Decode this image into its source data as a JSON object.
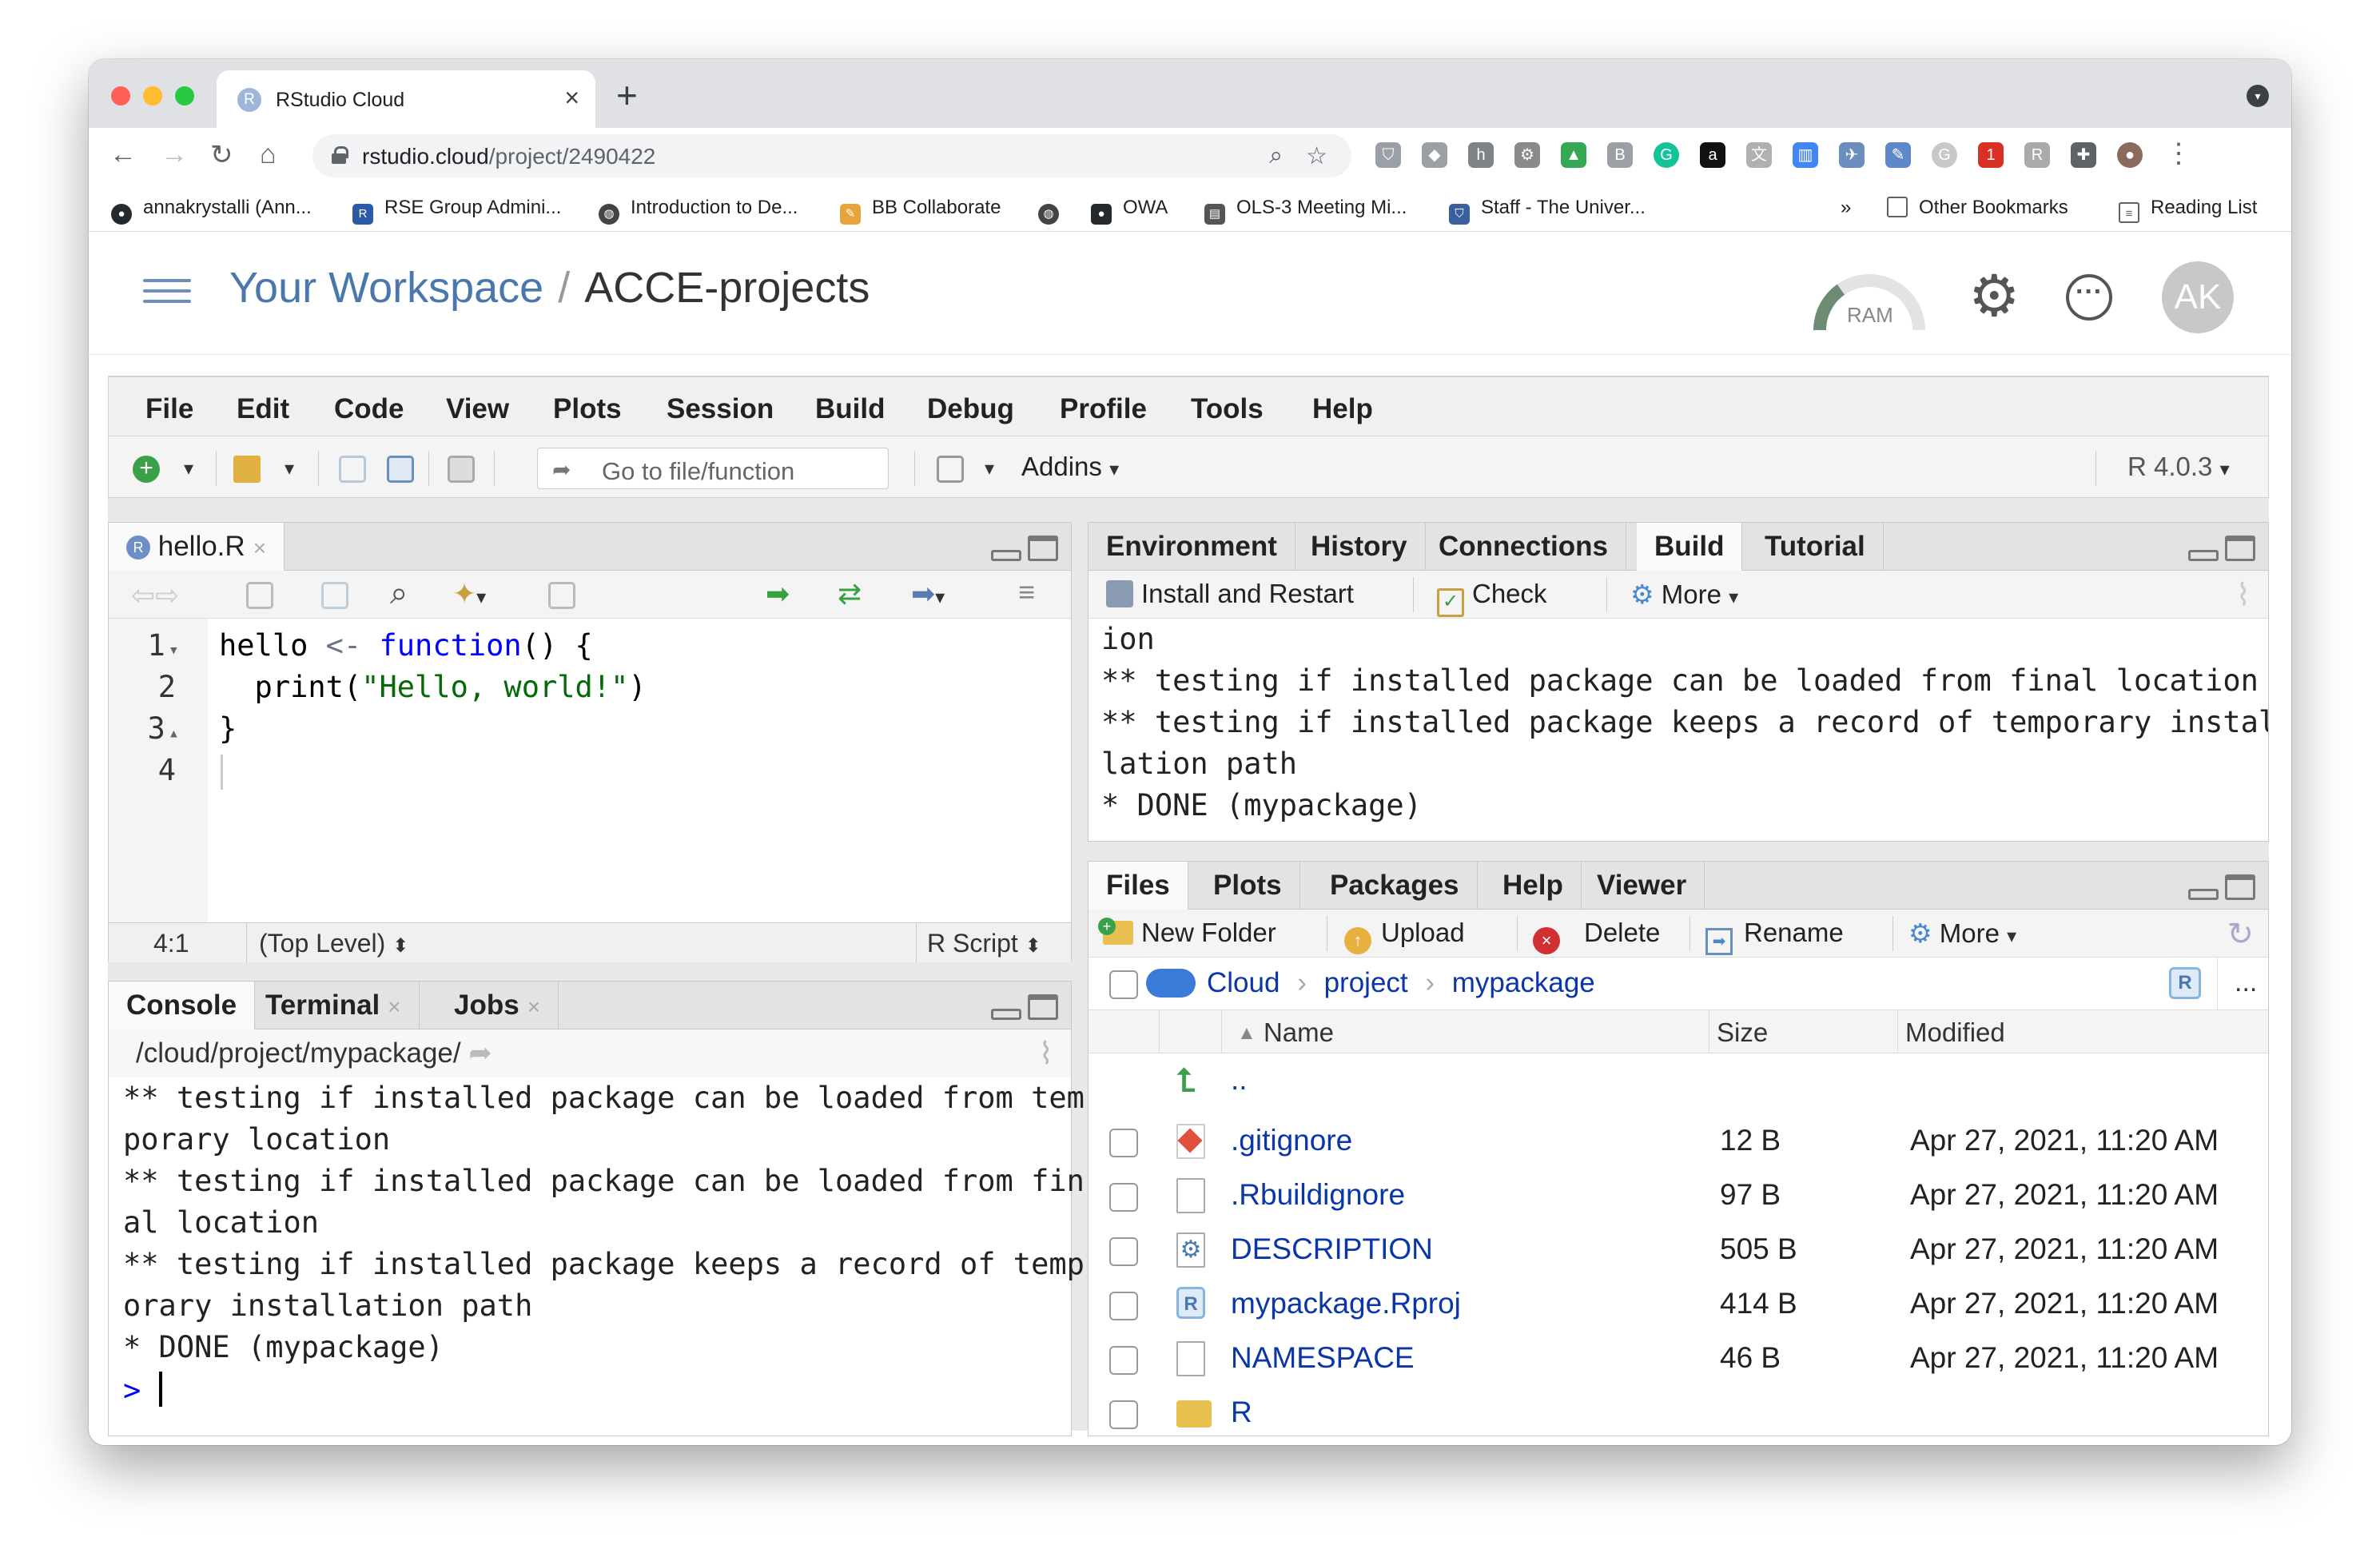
{
  "browser": {
    "tab_title": "RStudio Cloud",
    "tab_favicon": "R",
    "url_host": "rstudio.cloud",
    "url_path": "/project/2490422",
    "bookmarks": [
      {
        "label": "annakrystalli (Ann...",
        "icon": "github-icon",
        "color": "#24292e"
      },
      {
        "label": "RSE Group Admini...",
        "icon": "rse-icon",
        "color": "#2a5aa8"
      },
      {
        "label": "Introduction to De...",
        "icon": "globe-icon",
        "color": "#444"
      },
      {
        "label": "BB Collaborate",
        "icon": "pencil-icon",
        "color": "#e8a33b"
      },
      {
        "label": "",
        "icon": "globe-icon",
        "color": "#444"
      },
      {
        "label": "OWA",
        "icon": "github-icon",
        "color": "#24292e"
      },
      {
        "label": "OLS-3 Meeting Mi...",
        "icon": "document-icon",
        "color": "#555"
      },
      {
        "label": "Staff - The Univer...",
        "icon": "shield-icon",
        "color": "#3a5fa0"
      }
    ],
    "more_bookmarks": "»",
    "other_bookmarks": "Other Bookmarks",
    "reading_list": "Reading List"
  },
  "app": {
    "workspace": "Your Workspace",
    "separator": "/",
    "project": "ACCE-projects",
    "ram_label": "RAM",
    "avatar_initials": "AK"
  },
  "menu": [
    "File",
    "Edit",
    "Code",
    "View",
    "Plots",
    "Session",
    "Build",
    "Debug",
    "Profile",
    "Tools",
    "Help"
  ],
  "toolbar": {
    "goto_placeholder": "Go to file/function",
    "addins": "Addins",
    "r_version": "R 4.0.3"
  },
  "editor": {
    "tab": "hello.R",
    "lines": [
      {
        "n": "1",
        "fold": "▾"
      },
      {
        "n": "2",
        "fold": ""
      },
      {
        "n": "3",
        "fold": "▴"
      },
      {
        "n": "4",
        "fold": ""
      }
    ],
    "code": {
      "l1_a": "hello ",
      "l1_op": "<-",
      "l1_kw": "function",
      "l1_b": "() {",
      "l2_a": "  print(",
      "l2_str": "\"Hello, world!\"",
      "l2_b": ")",
      "l3": "}"
    },
    "cursor_pos": "4:1",
    "scope": "(Top Level)",
    "file_type": "R Script"
  },
  "console": {
    "tabs": [
      "Console",
      "Terminal",
      "Jobs"
    ],
    "path": "/cloud/project/mypackage/",
    "output": "** testing if installed package can be loaded from tem\nporary location\n** testing if installed package can be loaded from fin\nal location\n** testing if installed package keeps a record of temp\norary installation path\n* DONE (mypackage)",
    "prompt": ">"
  },
  "build": {
    "tabs": [
      "Environment",
      "History",
      "Connections",
      "Build",
      "Tutorial"
    ],
    "install_restart": "Install and Restart",
    "check": "Check",
    "more": "More",
    "output": "ion\n** testing if installed package can be loaded from final location\n** testing if installed package keeps a record of temporary instal\nlation path\n* DONE (mypackage)"
  },
  "files": {
    "tabs": [
      "Files",
      "Plots",
      "Packages",
      "Help",
      "Viewer"
    ],
    "new_folder": "New Folder",
    "upload": "Upload",
    "delete": "Delete",
    "rename": "Rename",
    "more": "More",
    "breadcrumb": [
      "Cloud",
      "project",
      "mypackage"
    ],
    "crumb_sep": "›",
    "overflow": "...",
    "columns": {
      "name": "Name",
      "size": "Size",
      "modified": "Modified"
    },
    "up": "..",
    "rows": [
      {
        "name": ".gitignore",
        "size": "12 B",
        "modified": "Apr 27, 2021, 11:20 AM",
        "icon": "git-icon"
      },
      {
        "name": ".Rbuildignore",
        "size": "97 B",
        "modified": "Apr 27, 2021, 11:20 AM",
        "icon": "file-icon"
      },
      {
        "name": "DESCRIPTION",
        "size": "505 B",
        "modified": "Apr 27, 2021, 11:20 AM",
        "icon": "gear-file-icon"
      },
      {
        "name": "mypackage.Rproj",
        "size": "414 B",
        "modified": "Apr 27, 2021, 11:20 AM",
        "icon": "rproj-icon"
      },
      {
        "name": "NAMESPACE",
        "size": "46 B",
        "modified": "Apr 27, 2021, 11:20 AM",
        "icon": "file-icon"
      },
      {
        "name": "R",
        "size": "",
        "modified": "",
        "icon": "folder-icon"
      }
    ]
  }
}
